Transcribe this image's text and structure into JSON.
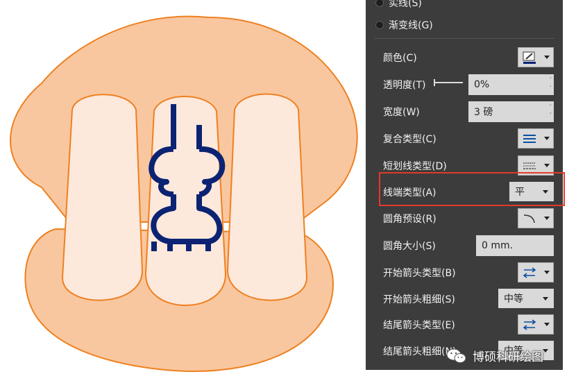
{
  "colors": {
    "outer_fill": "#f9c79f",
    "outer_stroke": "#ee8020",
    "inner_fill": "#fde8dc",
    "stroke_line": "#0b2372",
    "panel_bg": "#3c3c3c",
    "highlight": "#e23a2a"
  },
  "panel": {
    "radio_top": {
      "label": "实线(S)"
    },
    "radio_gradient": {
      "label": "渐变线(G)"
    },
    "rows": {
      "color": {
        "label": "颜色(C)",
        "icon": "pen-color-icon"
      },
      "transparency": {
        "label": "透明度(T)",
        "value": "0%"
      },
      "width": {
        "label": "宽度(W)",
        "value": "3 磅"
      },
      "compound": {
        "label": "复合类型(C)",
        "icon": "compound-lines-icon"
      },
      "dash": {
        "label": "短划线类型(D)",
        "icon": "dash-lines-icon"
      },
      "cap": {
        "label": "线端类型(A)",
        "value": "平"
      },
      "join": {
        "label": "圆角预设(R)",
        "icon": "corner-preset-icon"
      },
      "radius": {
        "label": "圆角大小(S)",
        "value": "0 mm."
      },
      "begin_arrow_type": {
        "label": "开始箭头类型(B)",
        "icon": "arrow-type-icon"
      },
      "begin_arrow_size": {
        "label": "开始箭头粗细(S)",
        "value": "中等"
      },
      "end_arrow_type": {
        "label": "结尾箭头类型(E)",
        "icon": "arrow-type-icon"
      },
      "end_arrow_size": {
        "label": "结尾箭头粗细(N)",
        "value": "中等"
      }
    }
  },
  "watermark": {
    "text": "博硕科研绘图",
    "icon": "wechat-icon"
  }
}
